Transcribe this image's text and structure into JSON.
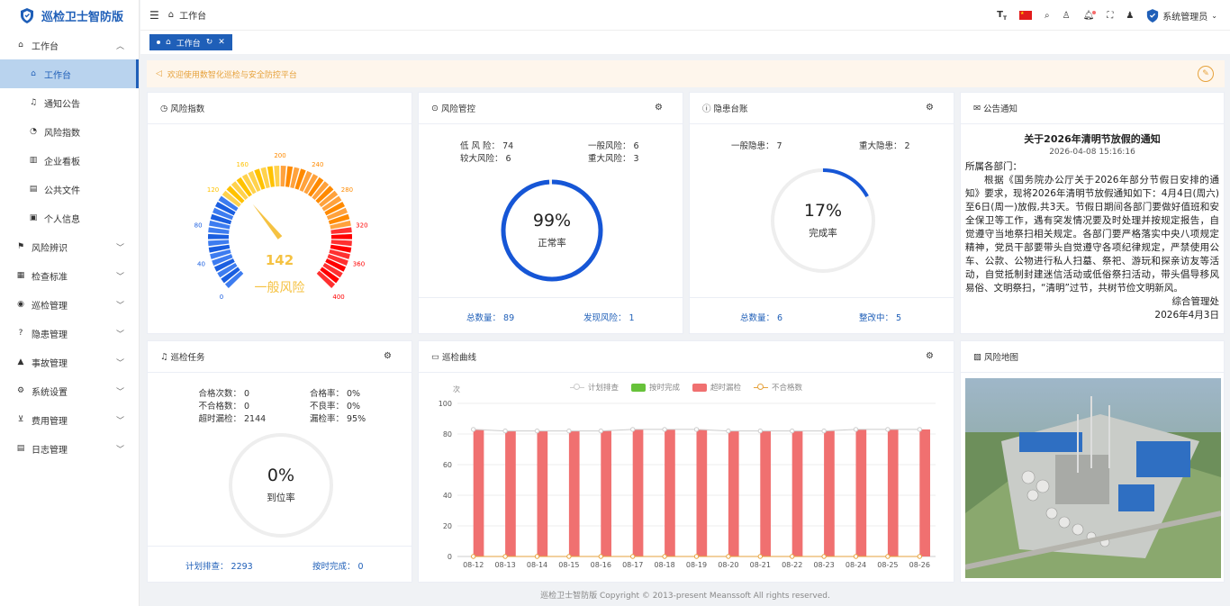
{
  "app": {
    "title": "巡检卫士智防版"
  },
  "sidebar": {
    "items": [
      {
        "label": "工作台",
        "icon": "home-icon",
        "expanded": true
      },
      {
        "label": "工作台",
        "icon": "home-icon",
        "sub": true,
        "active": true
      },
      {
        "label": "通知公告",
        "icon": "bell-icon",
        "sub": true
      },
      {
        "label": "风险指数",
        "icon": "pie-icon",
        "sub": true
      },
      {
        "label": "企业看板",
        "icon": "bar-chart-icon",
        "sub": true
      },
      {
        "label": "公共文件",
        "icon": "file-icon",
        "sub": true
      },
      {
        "label": "个人信息",
        "icon": "lock-icon",
        "sub": true
      },
      {
        "label": "风险辨识",
        "icon": "flag-icon"
      },
      {
        "label": "检查标准",
        "icon": "clipboard-icon"
      },
      {
        "label": "巡检管理",
        "icon": "eye-icon"
      },
      {
        "label": "隐患管理",
        "icon": "question-icon"
      },
      {
        "label": "事故管理",
        "icon": "warning-icon"
      },
      {
        "label": "系统设置",
        "icon": "gear-icon"
      },
      {
        "label": "费用管理",
        "icon": "cart-icon"
      },
      {
        "label": "日志管理",
        "icon": "doc-icon"
      }
    ]
  },
  "header": {
    "breadcrumb": "工作台",
    "user": "系统管理员"
  },
  "tab": {
    "label": "工作台"
  },
  "notice": {
    "text": "欢迎使用数智化巡检与安全防控平台"
  },
  "risk_index": {
    "title": "风险指数",
    "value": "142",
    "level": "一般风险",
    "ticks": [
      "0",
      "40",
      "80",
      "120",
      "160",
      "200",
      "240",
      "280",
      "320",
      "360",
      "400"
    ],
    "max": 400
  },
  "risk_control": {
    "title": "风险管控",
    "low_label": "低 风 险：",
    "low": "74",
    "general_label": "一般风险：",
    "general": "6",
    "higher_label": "较大风险：",
    "higher": "6",
    "major_label": "重大风险：",
    "major": "3",
    "percent": "99%",
    "percent_value": 99,
    "rate_label": "正常率",
    "total_label": "总数量：",
    "total": "89",
    "found_label": "发现风险：",
    "found": "1"
  },
  "hazard": {
    "title": "隐患台账",
    "general_label": "一般隐患：",
    "general": "7",
    "major_label": "重大隐患：",
    "major": "2",
    "percent": "17%",
    "percent_value": 17,
    "rate_label": "完成率",
    "total_label": "总数量：",
    "total": "6",
    "fixing_label": "整改中：",
    "fixing": "5"
  },
  "announcement": {
    "title": "公告通知",
    "heading": "关于2026年清明节放假的通知",
    "date": "2026-04-08 15:16:16",
    "salutation": "所属各部门：",
    "body": "根据《国务院办公厅关于2026年部分节假日安排的通知》要求，现将2026年清明节放假通知如下：4月4日(周六)至6日(周一)放假,共3天。节假日期间各部门要做好值班和安全保卫等工作，遇有突发情况要及时处理并按规定报告，自觉遵守当地祭扫相关规定。各部门要严格落实中央八项规定精神，党员干部要带头自觉遵守各项纪律规定，严禁使用公车、公款、公物进行私人扫墓、祭祀、游玩和探亲访友等活动，自觉抵制封建迷信活动或低俗祭扫活动，带头倡导移风易俗、文明祭扫，“清明”过节，共树节俭文明新风。",
    "signer": "综合管理处",
    "sign_date": "2026年4月3日"
  },
  "patrol_task": {
    "title": "巡检任务",
    "pass_count_label": "合格次数：",
    "pass_count": "0",
    "pass_rate_label": "合格率：",
    "pass_rate": "0%",
    "fail_count_label": "不合格数：",
    "fail_count": "0",
    "bad_rate_label": "不良率：",
    "bad_rate": "0%",
    "overdue_label": "超时漏检：",
    "overdue": "2144",
    "miss_rate_label": "漏检率：",
    "miss_rate": "95%",
    "percent": "0%",
    "percent_value": 0,
    "rate_label": "到位率",
    "plan_label": "计划排查：",
    "plan": "2293",
    "ontime_label": "按时完成：",
    "ontime": "0"
  },
  "patrol_curve": {
    "title": "巡检曲线",
    "unit": "次"
  },
  "risk_map": {
    "title": "风险地图"
  },
  "footer": {
    "copyright": "巡检卫士智防版 Copyright © 2013-present Meanssoft All rights reserved."
  },
  "chart_data": {
    "type": "bar",
    "categories": [
      "08-12",
      "08-13",
      "08-14",
      "08-15",
      "08-16",
      "08-17",
      "08-18",
      "08-19",
      "08-20",
      "08-21",
      "08-22",
      "08-23",
      "08-24",
      "08-25",
      "08-26"
    ],
    "series": [
      {
        "name": "计划排查",
        "type": "line",
        "color": "#cccccc",
        "values": [
          83,
          82,
          82,
          82,
          82,
          83,
          83,
          83,
          82,
          82,
          82,
          82,
          83,
          83,
          83
        ]
      },
      {
        "name": "按时完成",
        "type": "bar",
        "color": "#67c23a",
        "values": [
          0,
          0,
          0,
          0,
          0,
          0,
          0,
          0,
          0,
          0,
          0,
          0,
          0,
          0,
          0
        ]
      },
      {
        "name": "超时漏检",
        "type": "bar",
        "color": "#f07070",
        "values": [
          83,
          82,
          82,
          82,
          82,
          83,
          83,
          83,
          82,
          82,
          82,
          82,
          83,
          83,
          83
        ]
      },
      {
        "name": "不合格数",
        "type": "line",
        "color": "#e6a23c",
        "values": [
          0,
          0,
          0,
          0,
          0,
          0,
          0,
          0,
          0,
          0,
          0,
          0,
          0,
          0,
          0
        ]
      }
    ],
    "ylim": [
      0,
      100
    ],
    "yticks": [
      "0",
      "20",
      "40",
      "60",
      "80",
      "100"
    ],
    "ylabel": "次",
    "legend": "top-center",
    "grid": true
  }
}
